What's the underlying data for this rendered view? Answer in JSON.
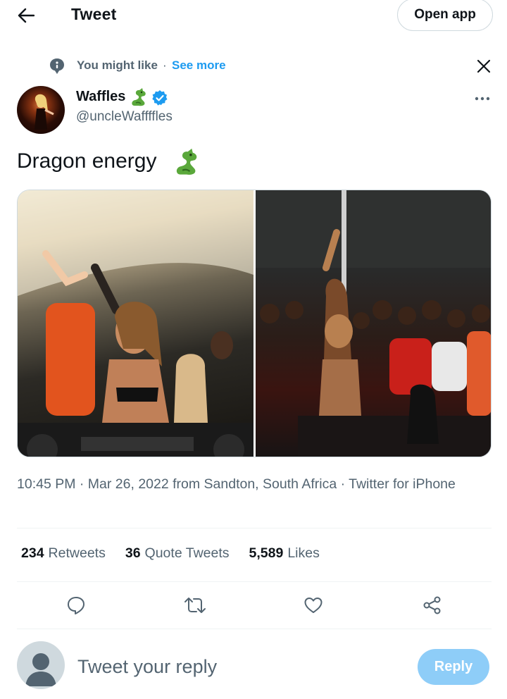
{
  "header": {
    "title": "Tweet",
    "open_app_label": "Open app",
    "back_icon": "arrow-left-icon"
  },
  "suggestion": {
    "label": "You might like",
    "separator": "·",
    "see_more": "See more",
    "icon": "speech-bubble-icon",
    "close_icon": "close-icon"
  },
  "tweet": {
    "author": {
      "display_name": "Waffles",
      "name_emoji": "dragon-icon",
      "verified": true,
      "handle": "@uncleWaffffles"
    },
    "text": "Dragon energy",
    "text_emoji": "dragon-icon",
    "media": [
      {
        "description_icon": "photo-icon"
      },
      {
        "description_icon": "photo-icon"
      }
    ],
    "timestamp": "10:45 PM · Mar 26, 2022 from Sandton, South Africa · Twitter for iPhone"
  },
  "stats": {
    "retweets_count": "234",
    "retweets_label": "Retweets",
    "quotes_count": "36",
    "quotes_label": "Quote Tweets",
    "likes_count": "5,589",
    "likes_label": "Likes"
  },
  "actions": [
    "reply-icon",
    "retweet-icon",
    "like-icon",
    "share-icon"
  ],
  "reply": {
    "placeholder": "Tweet your reply",
    "button_label": "Reply"
  },
  "colors": {
    "accent": "#1d9bf0",
    "reply_button": "#8ecdf8",
    "secondary_text": "#536471",
    "dragon": "#5aa83b"
  }
}
